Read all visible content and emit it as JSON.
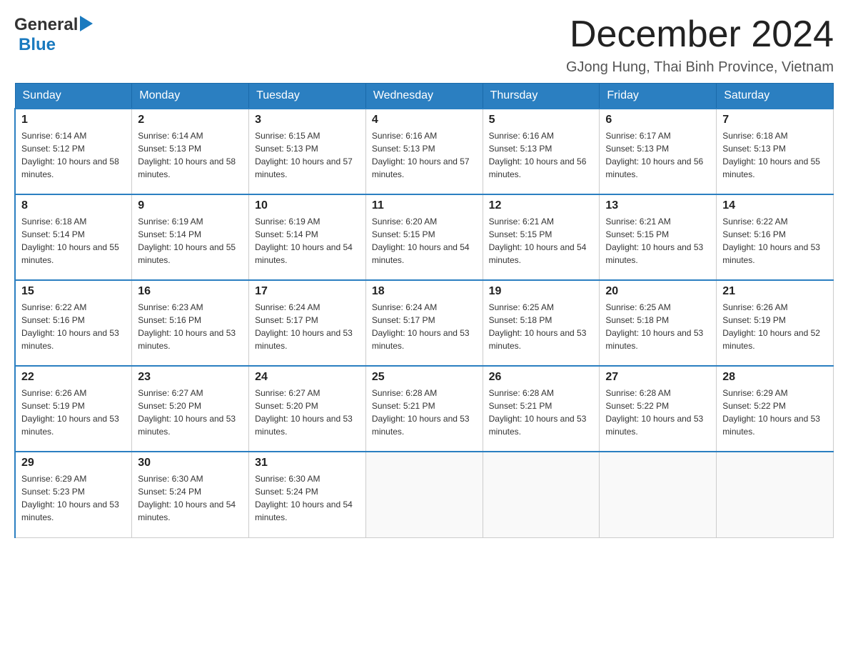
{
  "header": {
    "logo": {
      "general": "General",
      "blue": "Blue",
      "arrow_label": "arrow-icon"
    },
    "title": "December 2024",
    "location": "GJong Hung, Thai Binh Province, Vietnam"
  },
  "calendar": {
    "days_of_week": [
      "Sunday",
      "Monday",
      "Tuesday",
      "Wednesday",
      "Thursday",
      "Friday",
      "Saturday"
    ],
    "weeks": [
      [
        {
          "day": "1",
          "sunrise": "6:14 AM",
          "sunset": "5:12 PM",
          "daylight": "10 hours and 58 minutes."
        },
        {
          "day": "2",
          "sunrise": "6:14 AM",
          "sunset": "5:13 PM",
          "daylight": "10 hours and 58 minutes."
        },
        {
          "day": "3",
          "sunrise": "6:15 AM",
          "sunset": "5:13 PM",
          "daylight": "10 hours and 57 minutes."
        },
        {
          "day": "4",
          "sunrise": "6:16 AM",
          "sunset": "5:13 PM",
          "daylight": "10 hours and 57 minutes."
        },
        {
          "day": "5",
          "sunrise": "6:16 AM",
          "sunset": "5:13 PM",
          "daylight": "10 hours and 56 minutes."
        },
        {
          "day": "6",
          "sunrise": "6:17 AM",
          "sunset": "5:13 PM",
          "daylight": "10 hours and 56 minutes."
        },
        {
          "day": "7",
          "sunrise": "6:18 AM",
          "sunset": "5:13 PM",
          "daylight": "10 hours and 55 minutes."
        }
      ],
      [
        {
          "day": "8",
          "sunrise": "6:18 AM",
          "sunset": "5:14 PM",
          "daylight": "10 hours and 55 minutes."
        },
        {
          "day": "9",
          "sunrise": "6:19 AM",
          "sunset": "5:14 PM",
          "daylight": "10 hours and 55 minutes."
        },
        {
          "day": "10",
          "sunrise": "6:19 AM",
          "sunset": "5:14 PM",
          "daylight": "10 hours and 54 minutes."
        },
        {
          "day": "11",
          "sunrise": "6:20 AM",
          "sunset": "5:15 PM",
          "daylight": "10 hours and 54 minutes."
        },
        {
          "day": "12",
          "sunrise": "6:21 AM",
          "sunset": "5:15 PM",
          "daylight": "10 hours and 54 minutes."
        },
        {
          "day": "13",
          "sunrise": "6:21 AM",
          "sunset": "5:15 PM",
          "daylight": "10 hours and 53 minutes."
        },
        {
          "day": "14",
          "sunrise": "6:22 AM",
          "sunset": "5:16 PM",
          "daylight": "10 hours and 53 minutes."
        }
      ],
      [
        {
          "day": "15",
          "sunrise": "6:22 AM",
          "sunset": "5:16 PM",
          "daylight": "10 hours and 53 minutes."
        },
        {
          "day": "16",
          "sunrise": "6:23 AM",
          "sunset": "5:16 PM",
          "daylight": "10 hours and 53 minutes."
        },
        {
          "day": "17",
          "sunrise": "6:24 AM",
          "sunset": "5:17 PM",
          "daylight": "10 hours and 53 minutes."
        },
        {
          "day": "18",
          "sunrise": "6:24 AM",
          "sunset": "5:17 PM",
          "daylight": "10 hours and 53 minutes."
        },
        {
          "day": "19",
          "sunrise": "6:25 AM",
          "sunset": "5:18 PM",
          "daylight": "10 hours and 53 minutes."
        },
        {
          "day": "20",
          "sunrise": "6:25 AM",
          "sunset": "5:18 PM",
          "daylight": "10 hours and 53 minutes."
        },
        {
          "day": "21",
          "sunrise": "6:26 AM",
          "sunset": "5:19 PM",
          "daylight": "10 hours and 52 minutes."
        }
      ],
      [
        {
          "day": "22",
          "sunrise": "6:26 AM",
          "sunset": "5:19 PM",
          "daylight": "10 hours and 53 minutes."
        },
        {
          "day": "23",
          "sunrise": "6:27 AM",
          "sunset": "5:20 PM",
          "daylight": "10 hours and 53 minutes."
        },
        {
          "day": "24",
          "sunrise": "6:27 AM",
          "sunset": "5:20 PM",
          "daylight": "10 hours and 53 minutes."
        },
        {
          "day": "25",
          "sunrise": "6:28 AM",
          "sunset": "5:21 PM",
          "daylight": "10 hours and 53 minutes."
        },
        {
          "day": "26",
          "sunrise": "6:28 AM",
          "sunset": "5:21 PM",
          "daylight": "10 hours and 53 minutes."
        },
        {
          "day": "27",
          "sunrise": "6:28 AM",
          "sunset": "5:22 PM",
          "daylight": "10 hours and 53 minutes."
        },
        {
          "day": "28",
          "sunrise": "6:29 AM",
          "sunset": "5:22 PM",
          "daylight": "10 hours and 53 minutes."
        }
      ],
      [
        {
          "day": "29",
          "sunrise": "6:29 AM",
          "sunset": "5:23 PM",
          "daylight": "10 hours and 53 minutes."
        },
        {
          "day": "30",
          "sunrise": "6:30 AM",
          "sunset": "5:24 PM",
          "daylight": "10 hours and 54 minutes."
        },
        {
          "day": "31",
          "sunrise": "6:30 AM",
          "sunset": "5:24 PM",
          "daylight": "10 hours and 54 minutes."
        },
        null,
        null,
        null,
        null
      ]
    ]
  }
}
